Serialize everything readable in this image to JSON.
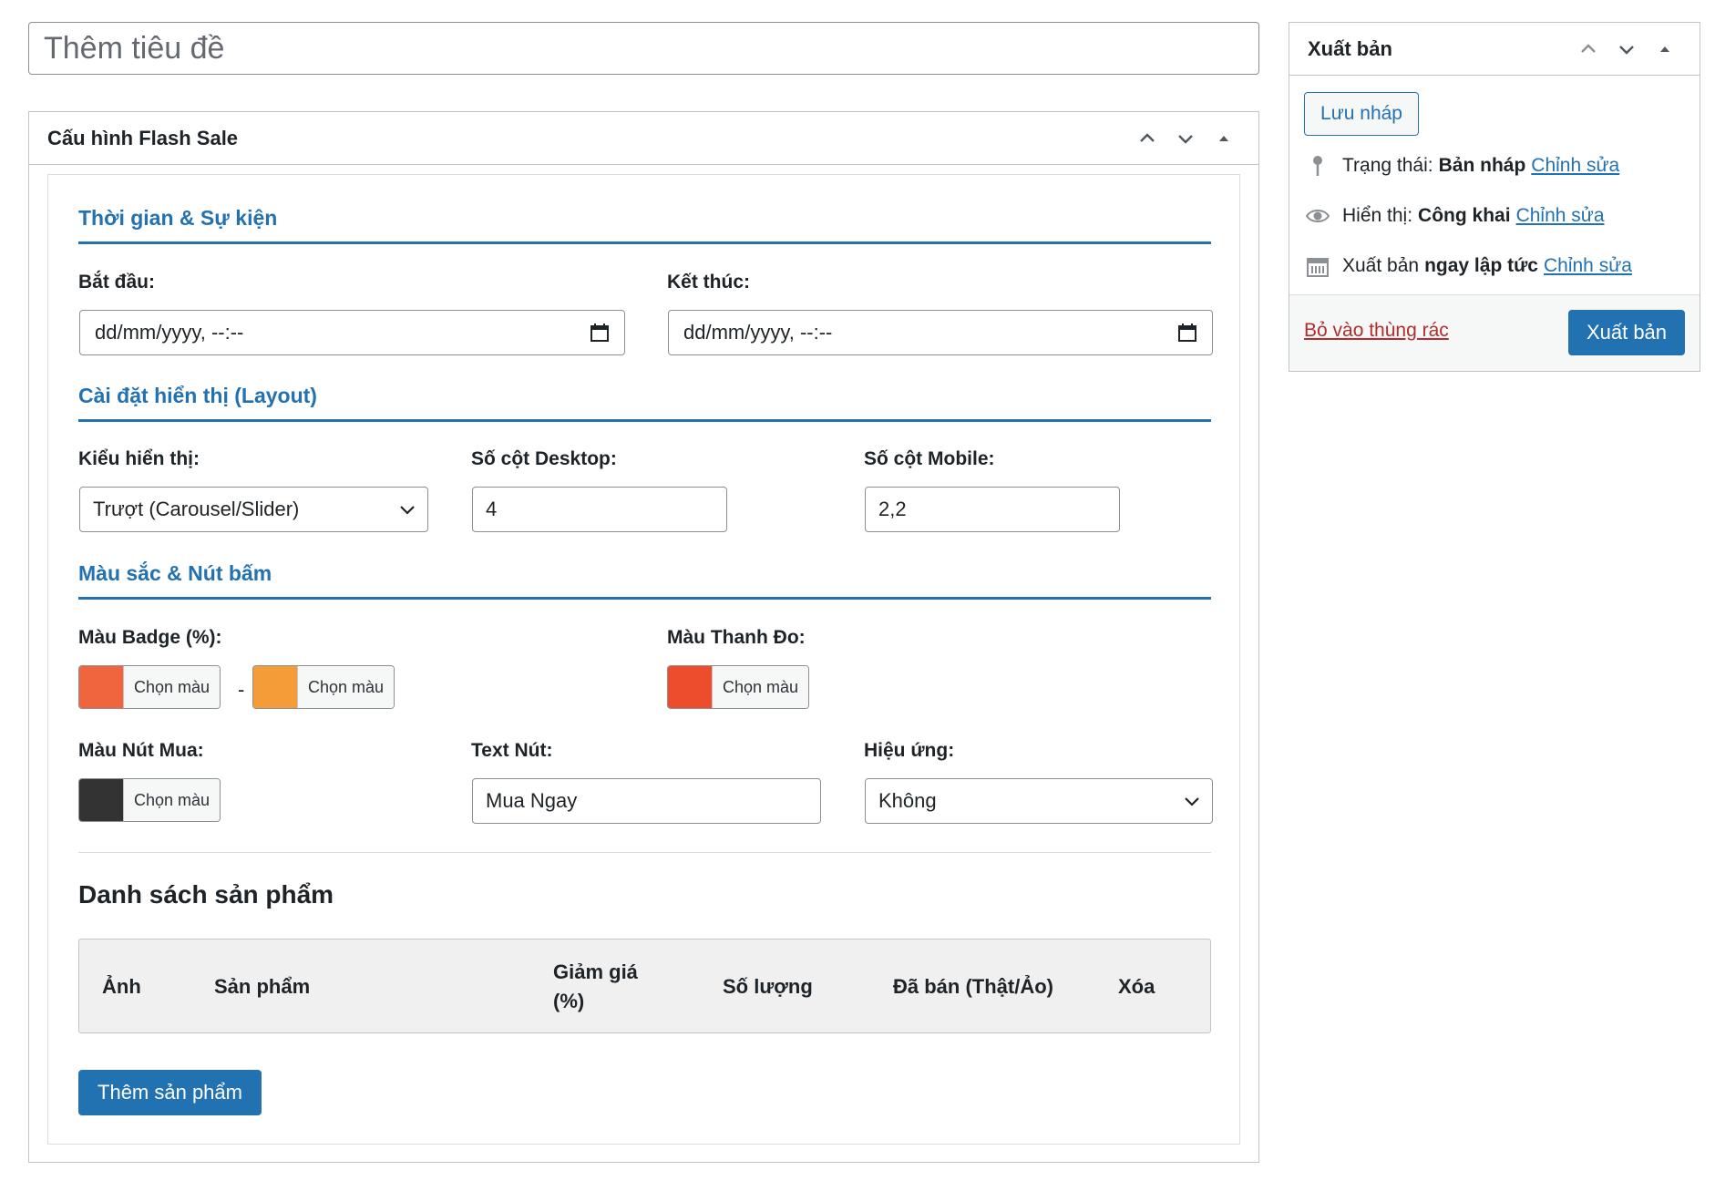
{
  "title_input": {
    "placeholder": "Thêm tiêu đề"
  },
  "flash_box": {
    "title": "Cấu hình Flash Sale",
    "sections": {
      "time": "Thời gian & Sự kiện",
      "layout": "Cài đặt hiển thị (Layout)",
      "colors": "Màu sắc & Nút bấm"
    },
    "start": {
      "label": "Bắt đầu:",
      "value": "dd/mm/yyyy, --:--"
    },
    "end": {
      "label": "Kết thúc:",
      "value": "dd/mm/yyyy, --:--"
    },
    "display_type": {
      "label": "Kiểu hiển thị:",
      "value": "Trượt (Carousel/Slider)"
    },
    "desktop_cols": {
      "label": "Số cột Desktop:",
      "value": "4"
    },
    "mobile_cols": {
      "label": "Số cột Mobile:",
      "value": "2,2"
    },
    "badge_color": {
      "label": "Màu Badge (%):",
      "color1": "#f0653e",
      "color2": "#f39c38",
      "button_label": "Chọn màu",
      "separator": "-"
    },
    "bar_color": {
      "label": "Màu Thanh Đo:",
      "color": "#ee4d2d",
      "button_label": "Chọn màu"
    },
    "buy_color": {
      "label": "Màu Nút Mua:",
      "color": "#333333",
      "button_label": "Chọn màu"
    },
    "button_text": {
      "label": "Text Nút:",
      "value": "Mua Ngay"
    },
    "effect": {
      "label": "Hiệu ứng:",
      "value": "Không"
    },
    "product_list": {
      "heading": "Danh sách sản phẩm",
      "columns": [
        "Ảnh",
        "Sản phẩm",
        "Giảm giá (%)",
        "Số lượng",
        "Đã bán (Thật/Ảo)",
        "Xóa"
      ],
      "add_button": "Thêm sản phẩm"
    }
  },
  "publish_box": {
    "title": "Xuất bản",
    "save_draft": "Lưu nháp",
    "status": {
      "label": "Trạng thái:",
      "value": "Bản nháp",
      "edit": "Chỉnh sửa"
    },
    "visibility": {
      "label": "Hiển thị:",
      "value": "Công khai",
      "edit": "Chỉnh sửa"
    },
    "schedule": {
      "label": "Xuất bản",
      "value": "ngay lập tức",
      "edit": "Chỉnh sửa"
    },
    "trash": "Bỏ vào thùng rác",
    "publish": "Xuất bản"
  },
  "colors": {
    "accent": "#2271b1",
    "danger": "#b32d2e"
  }
}
